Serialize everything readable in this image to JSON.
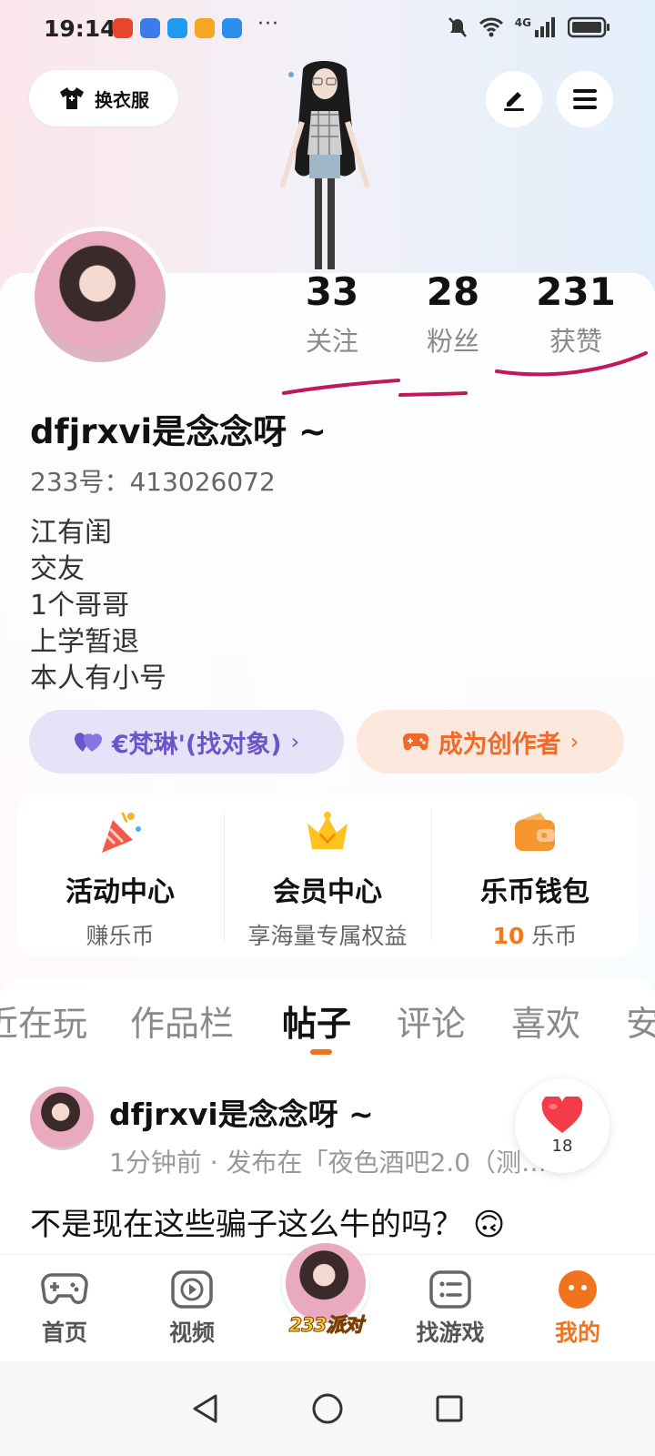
{
  "status_bar": {
    "time": "19:14",
    "dots": "···",
    "network": "4G"
  },
  "header": {
    "wardrobe_label": "换衣服"
  },
  "stats": [
    {
      "count": "33",
      "label": "关注"
    },
    {
      "count": "28",
      "label": "粉丝"
    },
    {
      "count": "231",
      "label": "获赞"
    }
  ],
  "profile": {
    "nickname": "dfjrxvi是念念呀 ~",
    "id_text": "233号：413026072",
    "bio": [
      "江有闺",
      "交友",
      "1个哥哥",
      "上学暂退",
      "本人有小号"
    ]
  },
  "pills": {
    "left_label": "€梵琳'(找对象)",
    "right_label": "成为创作者",
    "chevron": "›"
  },
  "services": [
    {
      "title": "活动中心",
      "sub": "赚乐币"
    },
    {
      "title": "会员中心",
      "sub": "享海量专属权益"
    },
    {
      "title": "乐币钱包",
      "sub_value": "10",
      "sub_unit": " 乐币"
    }
  ],
  "tabs": [
    "近在玩",
    "作品栏",
    "帖子",
    "评论",
    "喜欢",
    "安"
  ],
  "active_tab": "帖子",
  "post": {
    "author": "dfjrxvi是念念呀 ~",
    "meta": "1分钟前 · 发布在「夜色酒吧2.0（测…",
    "text": "不是现在这些骗子这么牛的吗？",
    "emoji": "🙃",
    "likes": "18"
  },
  "bottom_nav": {
    "home": "首页",
    "video": "视频",
    "party": "233派对",
    "games": "找游戏",
    "mine": "我的"
  },
  "colors": {
    "accent": "#f2731e",
    "purple": "#6c55c8",
    "orange": "#ef6a2a",
    "annotation": "#c2185b"
  }
}
